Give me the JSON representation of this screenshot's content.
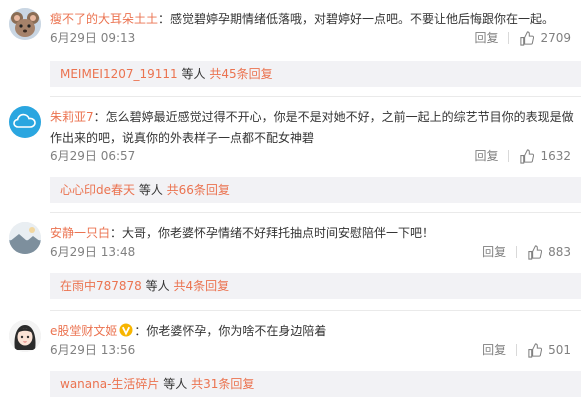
{
  "comments": [
    {
      "username": "瘦不了的大耳朵土土",
      "vip": false,
      "text": "：感觉碧婷孕期情绪低落哦，对碧婷好一点吧。不要让他后悔跟你在一起。",
      "time": "6月29日 09:13",
      "reply_label": "回复",
      "likes": "2709",
      "reply_user": "MEIMEI1207_19111",
      "reply_mid": " 等人 ",
      "reply_total": "共45条回复",
      "avatar": "cartoon-mouse-avatar"
    },
    {
      "username": "朱莉亚7",
      "vip": false,
      "text": "：怎么碧婷最近感觉过得不开心，你是不是对她不好，之前一起上的综艺节目你的表现是做作出来的吧，说真你的外表样子一点都不配女神碧",
      "time": "6月29日 06:57",
      "reply_label": "回复",
      "likes": "1632",
      "reply_user": "心心印de春天",
      "reply_mid": " 等人 ",
      "reply_total": "共66条回复",
      "avatar": "cloud-avatar"
    },
    {
      "username": "安静一只白",
      "vip": false,
      "text": "：大哥，你老婆怀孕情绪不好拜托抽点时间安慰陪伴一下吧！",
      "time": "6月29日 13:48",
      "reply_label": "回复",
      "likes": "883",
      "reply_user": "在雨中787878",
      "reply_mid": " 等人 ",
      "reply_total": "共4条回复",
      "avatar": "landscape-avatar"
    },
    {
      "username": "e股堂财文姬",
      "vip": true,
      "text": "：你老婆怀孕，你为啥不在身边陪着",
      "time": "6月29日 13:56",
      "reply_label": "回复",
      "likes": "501",
      "reply_user": "wanana-生活碎片",
      "reply_mid": " 等人 ",
      "reply_total": "共31条回复",
      "avatar": "anime-girl-avatar"
    }
  ],
  "colors": {
    "username": "#eb7350",
    "reply_bg": "#f2f2f5",
    "meta": "#808080"
  }
}
